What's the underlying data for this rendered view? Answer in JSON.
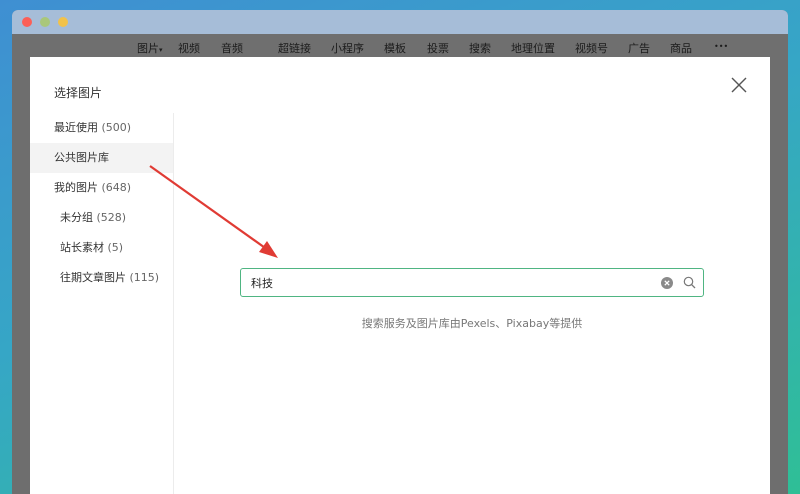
{
  "toolbar": {
    "items": [
      "图片",
      "视频",
      "音频",
      "超链接",
      "小程序",
      "模板",
      "投票",
      "搜索",
      "地理位置",
      "视频号",
      "广告",
      "商品"
    ],
    "more": "•••",
    "image_dropdown_caret": "▾"
  },
  "dialog": {
    "title": "选择图片"
  },
  "sidebar": {
    "items": [
      {
        "label": "最近使用",
        "count": "(500)"
      },
      {
        "label": "公共图片库",
        "count": ""
      },
      {
        "label": "我的图片",
        "count": "(648)"
      },
      {
        "label": "未分组",
        "count": "(528)"
      },
      {
        "label": "站长素材",
        "count": "(5)"
      },
      {
        "label": "往期文章图片",
        "count": "(115)"
      }
    ],
    "active_index": 1
  },
  "search": {
    "value": "科技",
    "placeholder": ""
  },
  "hint": "搜索服务及图片库由Pexels、Pixabay等提供",
  "colors": {
    "accent": "#4fb582",
    "annotation_arrow": "#e03b34"
  },
  "icons": [
    "close-icon",
    "clear-icon",
    "search-icon"
  ]
}
